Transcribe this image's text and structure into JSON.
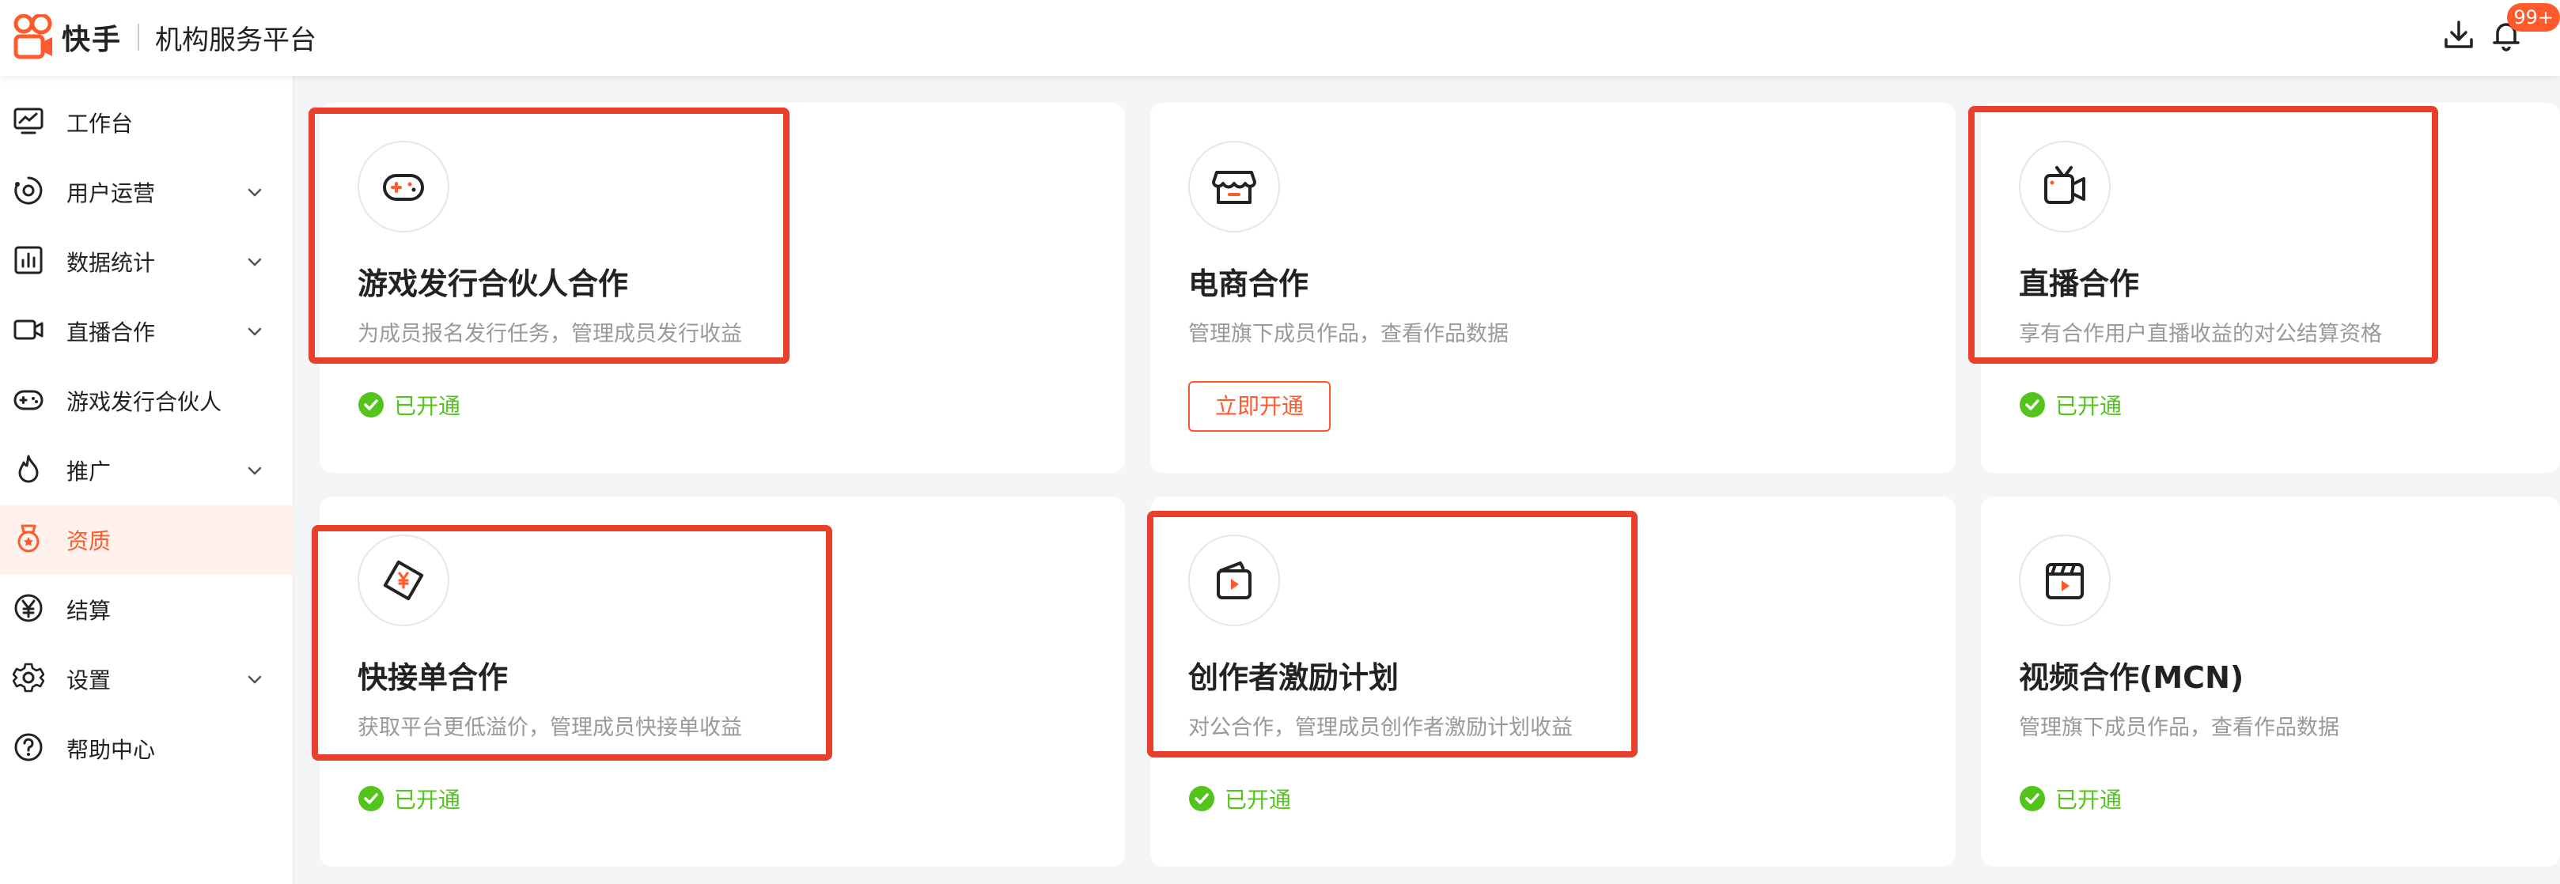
{
  "header": {
    "brand": "快手",
    "platform": "机构服务平台",
    "notification_badge": "99+",
    "icons": [
      "download-icon",
      "bell-icon"
    ]
  },
  "sidebar": {
    "items": [
      {
        "label": "工作台",
        "icon": "dashboard-icon",
        "expandable": false,
        "active": false
      },
      {
        "label": "用户运营",
        "icon": "user-ops-icon",
        "expandable": true,
        "active": false
      },
      {
        "label": "数据统计",
        "icon": "stats-icon",
        "expandable": true,
        "active": false
      },
      {
        "label": "直播合作",
        "icon": "video-camera-icon",
        "expandable": true,
        "active": false
      },
      {
        "label": "游戏发行合伙人",
        "icon": "gamepad-icon",
        "expandable": false,
        "active": false
      },
      {
        "label": "推广",
        "icon": "flame-icon",
        "expandable": true,
        "active": false
      },
      {
        "label": "资质",
        "icon": "badge-icon",
        "expandable": false,
        "active": true
      },
      {
        "label": "结算",
        "icon": "yen-icon",
        "expandable": false,
        "active": false
      },
      {
        "label": "设置",
        "icon": "gear-icon",
        "expandable": true,
        "active": false
      },
      {
        "label": "帮助中心",
        "icon": "help-icon",
        "expandable": false,
        "active": false
      }
    ]
  },
  "cards": [
    {
      "title": "游戏发行合伙人合作",
      "desc": "为成员报名发行任务，管理成员发行收益",
      "status": "已开通",
      "icon": "gamepad-icon"
    },
    {
      "title": "电商合作",
      "desc": "管理旗下成员作品，查看作品数据",
      "action": "立即开通",
      "icon": "shop-icon"
    },
    {
      "title": "直播合作",
      "desc": "享有合作用户直播收益的对公结算资格",
      "status": "已开通",
      "icon": "video-camera-icon"
    },
    {
      "title": "快接单合作",
      "desc": "获取平台更低溢价，管理成员快接单收益",
      "status": "已开通",
      "icon": "ticket-yen-icon"
    },
    {
      "title": "创作者激励计划",
      "desc": "对公合作，管理成员创作者激励计划收益",
      "status": "已开通",
      "icon": "creator-video-icon"
    },
    {
      "title": "视频合作(MCN)",
      "desc": "管理旗下成员作品，查看作品数据",
      "status": "已开通",
      "icon": "clapperboard-icon"
    }
  ],
  "colors": {
    "accent": "#ff5a2b",
    "success": "#52c41a",
    "highlight": "#e8402d"
  }
}
